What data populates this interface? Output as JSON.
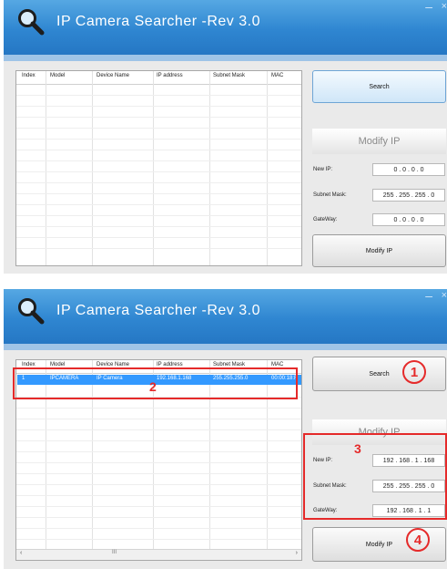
{
  "app": {
    "title": "IP Camera Searcher -Rev 3.0",
    "minimize": "–",
    "close": "×"
  },
  "table": {
    "columns": [
      "Index",
      "Model",
      "Device Name",
      "IP address",
      "Subnet Mask",
      "MAC"
    ],
    "rows_after": [
      {
        "index": "1",
        "model": "IPCAMERA",
        "device_name": "IP Camera",
        "ip": "192.168.1.168",
        "subnet": "255.255.255.0",
        "mac": "00:00:18:F"
      }
    ],
    "scroll_left": "‹",
    "scroll_right": "›",
    "scroll_grip": "III"
  },
  "buttons": {
    "search": "Search",
    "modify_ip": "Modify IP"
  },
  "modify": {
    "heading": "Modify IP"
  },
  "fields": {
    "new_ip_label": "New IP:",
    "subnet_label": "Subnet Mask:",
    "gateway_label": "GateWay:"
  },
  "before": {
    "new_ip": "0 . 0 . 0 . 0",
    "subnet": "255 . 255 . 255 . 0",
    "gateway": "0 . 0 . 0 . 0"
  },
  "after": {
    "new_ip": "192 . 168 . 1 . 168",
    "subnet": "255 . 255 . 255 . 0",
    "gateway": "192 . 168 . 1 . 1"
  },
  "annotations": {
    "step1": "1",
    "step2": "2",
    "step3": "3",
    "step4": "4"
  },
  "colors": {
    "title_bar": "#2f86d1",
    "selection": "#3399ff",
    "annotation": "#e52a2a"
  }
}
